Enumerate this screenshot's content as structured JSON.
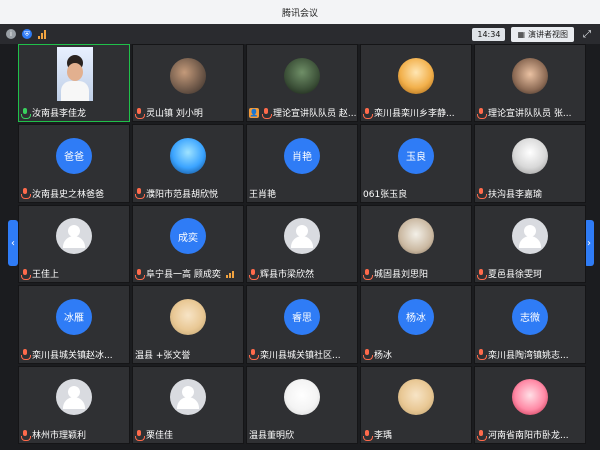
{
  "window": {
    "title": "腾讯会议"
  },
  "toolbar": {
    "time": "14:34",
    "presenter_view_label": "演讲者视图"
  },
  "tiles": [
    {
      "name": "汝南县李佳龙",
      "mic": "on",
      "active": true
    },
    {
      "name": "灵山镇 刘小明",
      "mic": "off"
    },
    {
      "name": "理论宣讲队队员 赵...",
      "mic": "off",
      "badge": "user"
    },
    {
      "name": "栾川县栾川乡李静...",
      "mic": "off"
    },
    {
      "name": "理论宣讲队队员 张...",
      "mic": "off"
    },
    {
      "name": "汝南县史之林爸爸",
      "mic": "off",
      "avatar_text": "爸爸"
    },
    {
      "name": "濮阳市范县胡欣悦",
      "mic": "off"
    },
    {
      "name": "王肖艳",
      "mic": "none",
      "avatar_text": "肖艳"
    },
    {
      "name": "061张玉良",
      "mic": "none",
      "avatar_text": "玉良"
    },
    {
      "name": "扶沟县李嘉瑜",
      "mic": "off"
    },
    {
      "name": "王佳上",
      "mic": "off"
    },
    {
      "name": "阜宁县一高 顾成奕",
      "mic": "off",
      "avatar_text": "成奕",
      "signal": true
    },
    {
      "name": "辉县市梁欣然",
      "mic": "off"
    },
    {
      "name": "城固县刘思阳",
      "mic": "off"
    },
    {
      "name": "夏邑县徐雯珂",
      "mic": "off"
    },
    {
      "name": "栾川县城关镇赵冰...",
      "mic": "off",
      "avatar_text": "冰雁"
    },
    {
      "name": "温县 +张文誉",
      "mic": "none"
    },
    {
      "name": "栾川县城关镇社区...",
      "mic": "off",
      "avatar_text": "睿思"
    },
    {
      "name": "杨冰",
      "mic": "off",
      "avatar_text": "杨冰"
    },
    {
      "name": "栾川县陶湾镇姚志...",
      "mic": "off",
      "avatar_text": "志微"
    },
    {
      "name": "林州市理颖利",
      "mic": "off"
    },
    {
      "name": "栗佳佳",
      "mic": "off"
    },
    {
      "name": "温县董明欣",
      "mic": "none"
    },
    {
      "name": "李瑀",
      "mic": "off"
    },
    {
      "name": "河南省南阳市卧龙...",
      "mic": "off"
    }
  ]
}
